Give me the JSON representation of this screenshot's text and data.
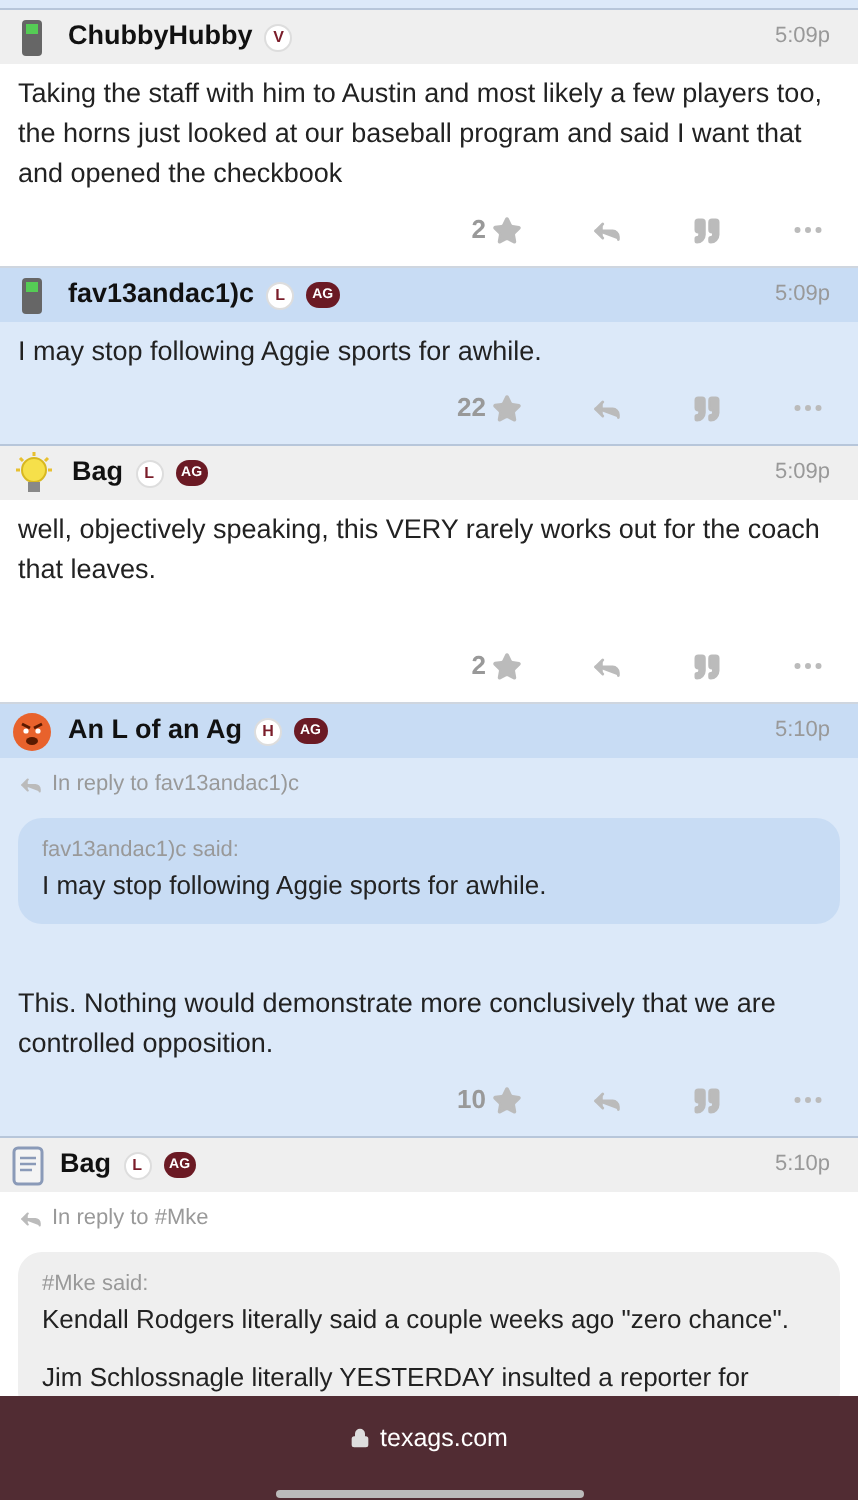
{
  "posts": [
    {
      "kind": "phone",
      "author": "ChubbyHubby",
      "badges": [
        {
          "kind": "circle",
          "text": "V"
        }
      ],
      "time": "5:09p",
      "highlighted": false,
      "paragraphs": [
        "Taking the staff with him to Austin and most likely a few players too, the horns just looked at our baseball program and said I want that and opened the checkbook"
      ],
      "likes": "2"
    },
    {
      "kind": "phone",
      "author": "fav13andac1)c",
      "badges": [
        {
          "kind": "circle",
          "text": "L"
        },
        {
          "kind": "pill",
          "text": "AG"
        }
      ],
      "time": "5:09p",
      "highlighted": true,
      "paragraphs": [
        "I may stop following Aggie sports for awhile."
      ],
      "likes": "22"
    },
    {
      "kind": "bulb",
      "author": "Bag",
      "badges": [
        {
          "kind": "circle",
          "text": "L"
        },
        {
          "kind": "pill",
          "text": "AG"
        }
      ],
      "time": "5:09p",
      "highlighted": false,
      "paragraphs": [
        "well, objectively speaking, this VERY rarely works out for the coach that leaves."
      ],
      "likes": "2"
    },
    {
      "kind": "angry",
      "author": "An L of an Ag",
      "badges": [
        {
          "kind": "circle",
          "text": "H"
        },
        {
          "kind": "pill",
          "text": "AG"
        }
      ],
      "time": "5:10p",
      "highlighted": true,
      "reply_to": "In reply to fav13andac1)c",
      "quote": {
        "said": "fav13andac1)c said:",
        "paragraphs": [
          "I may stop following Aggie sports for awhile."
        ]
      },
      "paragraphs": [
        "This. Nothing would demonstrate more conclusively that we are controlled opposition."
      ],
      "likes": "10"
    },
    {
      "kind": "notepad",
      "author": "Bag",
      "badges": [
        {
          "kind": "circle",
          "text": "L"
        },
        {
          "kind": "pill",
          "text": "AG"
        }
      ],
      "time": "5:10p",
      "highlighted": false,
      "reply_to": "In reply to #Mke",
      "quote": {
        "said": "#Mke said:",
        "paragraphs": [
          "Kendall Rodgers literally said a couple weeks ago \"zero chance\".",
          "Jim Schlossnagle literally YESTERDAY insulted a reporter for"
        ]
      }
    }
  ],
  "address_bar": {
    "url": "texags.com"
  }
}
